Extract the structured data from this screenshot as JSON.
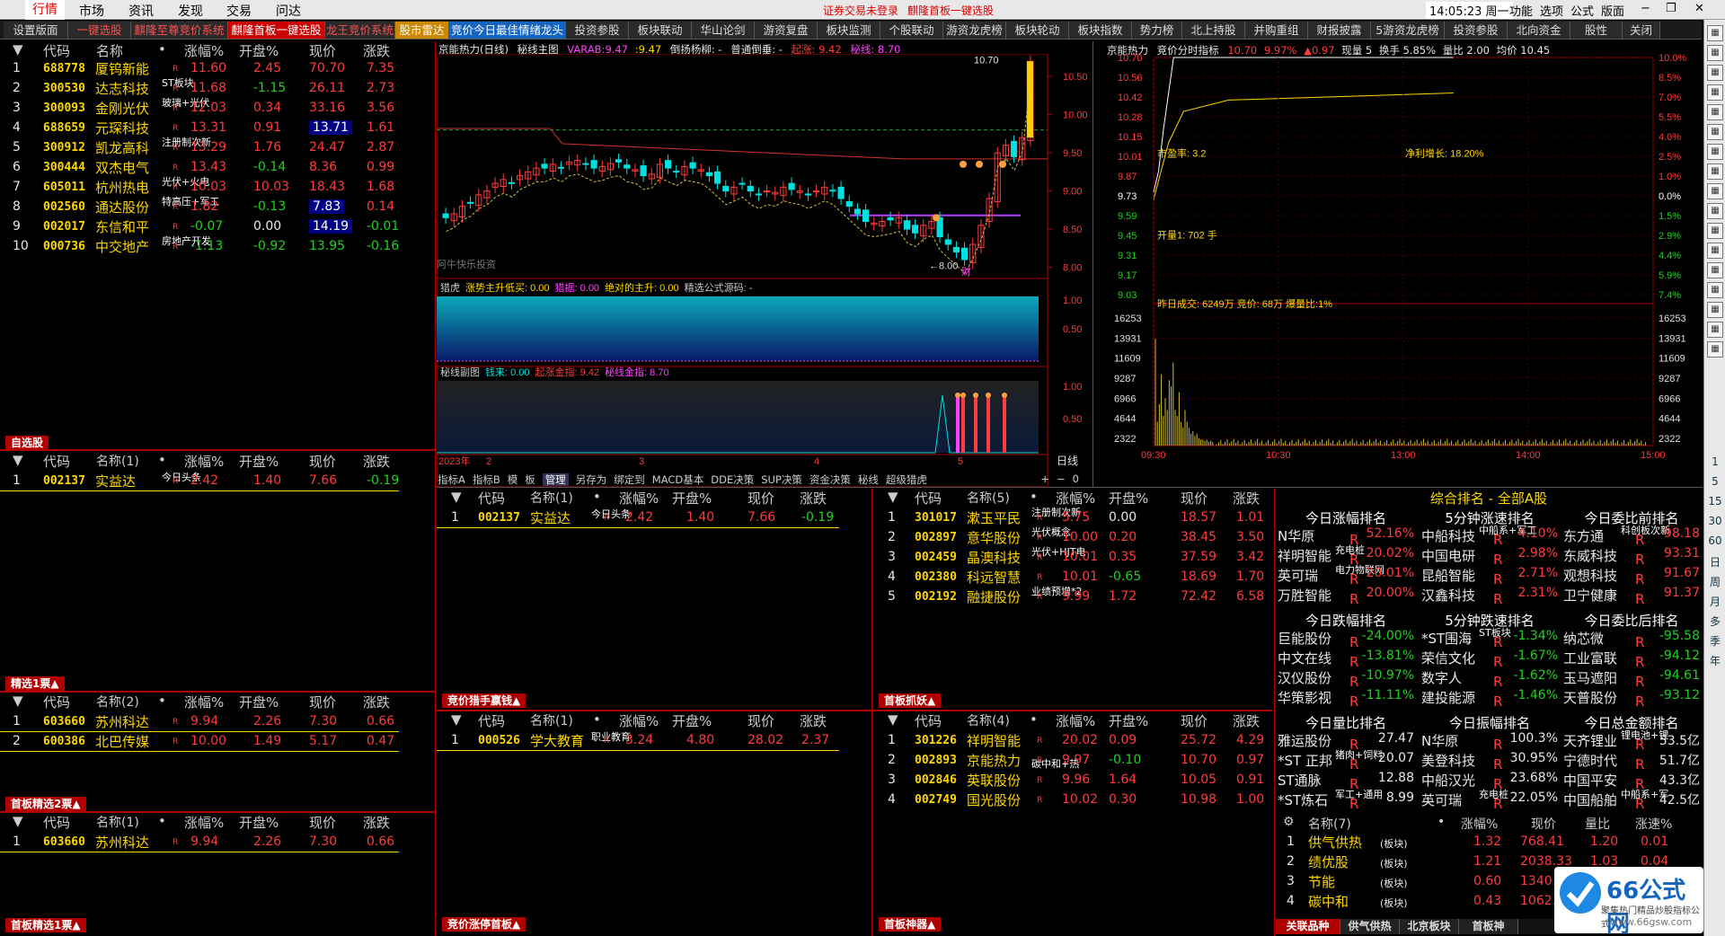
{
  "menu": {
    "items": [
      "行情",
      "市场",
      "资讯",
      "发现",
      "交易",
      "问达"
    ],
    "status_login": "证券交易未登录",
    "status_module": "麒隆首板一键选股",
    "clock": "14:05:23 周一",
    "right_items": [
      "功能",
      "选项",
      "公式",
      "版面",
      "−",
      "❐",
      "✕"
    ]
  },
  "tabs": [
    {
      "label": "设置版面",
      "style": "norm"
    },
    {
      "label": "一键选股",
      "style": "red"
    },
    {
      "label": "麒隆至尊竞价系统",
      "style": "red"
    },
    {
      "label": "麒隆首板一键选股",
      "style": "act"
    },
    {
      "label": "龙王竞价系统",
      "style": "red"
    },
    {
      "label": "股市雷达",
      "style": "yel"
    },
    {
      "label": "竞价今日最佳情绪龙头",
      "style": "cyn"
    },
    {
      "label": "投资参股",
      "style": "norm"
    },
    {
      "label": "板块联动",
      "style": "norm"
    },
    {
      "label": "华山论剑",
      "style": "norm"
    },
    {
      "label": "游资复盘",
      "style": "norm"
    },
    {
      "label": "板块监测",
      "style": "norm"
    },
    {
      "label": "个股联动",
      "style": "norm"
    },
    {
      "label": "游资龙虎榜",
      "style": "norm"
    },
    {
      "label": "板块轮动",
      "style": "norm"
    },
    {
      "label": "板块指数",
      "style": "norm"
    },
    {
      "label": "势力榜",
      "style": "norm"
    },
    {
      "label": "北上持股",
      "style": "norm"
    },
    {
      "label": "并购重组",
      "style": "norm"
    },
    {
      "label": "财报披露",
      "style": "norm"
    },
    {
      "label": "5游资龙虎榜",
      "style": "norm"
    },
    {
      "label": "投资参股",
      "style": "norm"
    },
    {
      "label": "北向资金",
      "style": "norm"
    },
    {
      "label": "股性",
      "style": "norm"
    },
    {
      "label": "关闭",
      "style": "norm"
    }
  ],
  "headers": {
    "code": "代码",
    "name": "名称",
    "dot": "•",
    "chg": "涨幅%",
    "open": "开盘%",
    "price": "现价",
    "diff": "涨跌"
  },
  "top_list": [
    {
      "n": "1",
      "code": "688778",
      "name": "厦钨新能",
      "tag": "",
      "chg": "11.60",
      "open": "2.45",
      "price": "70.70",
      "diff": "7.35",
      "oc": "red",
      "pc": "red",
      "hl": false
    },
    {
      "n": "2",
      "code": "300530",
      "name": "达志科技",
      "tag": "ST板块",
      "chg": "11.68",
      "open": "-1.15",
      "price": "26.11",
      "diff": "2.73",
      "oc": "grn",
      "pc": "red",
      "hl": false
    },
    {
      "n": "3",
      "code": "300093",
      "name": "金刚光伏",
      "tag": "玻璃+光伏",
      "chg": "12.03",
      "open": "0.34",
      "price": "33.16",
      "diff": "3.56",
      "oc": "red",
      "pc": "red",
      "hl": false
    },
    {
      "n": "4",
      "code": "688659",
      "name": "元琛科技",
      "tag": "",
      "chg": "13.31",
      "open": "0.91",
      "price": "13.71",
      "diff": "1.61",
      "oc": "red",
      "pc": "wht",
      "hl": true
    },
    {
      "n": "5",
      "code": "300912",
      "name": "凯龙高科",
      "tag": "注册制次新",
      "chg": "13.29",
      "open": "1.76",
      "price": "24.47",
      "diff": "2.87",
      "oc": "red",
      "pc": "red",
      "hl": false
    },
    {
      "n": "6",
      "code": "300444",
      "name": "双杰电气",
      "tag": "",
      "chg": "13.43",
      "open": "-0.14",
      "price": "8.36",
      "diff": "0.99",
      "oc": "grn",
      "pc": "red",
      "hl": false
    },
    {
      "n": "7",
      "code": "605011",
      "name": "杭州热电",
      "tag": "光伏+火电",
      "chg": "10.03",
      "open": "10.03",
      "price": "18.43",
      "diff": "1.68",
      "oc": "red",
      "pc": "red",
      "hl": false
    },
    {
      "n": "8",
      "code": "002560",
      "name": "通达股份",
      "tag": "特高压+军工",
      "chg": "1.82",
      "open": "-0.13",
      "price": "7.83",
      "diff": "0.14",
      "oc": "grn",
      "pc": "wht",
      "hl": true
    },
    {
      "n": "9",
      "code": "002017",
      "name": "东信和平",
      "tag": "",
      "chg": "-0.07",
      "open": "0.00",
      "price": "14.19",
      "diff": "-0.01",
      "oc": "wht",
      "pc": "wht",
      "hl": true
    },
    {
      "n": "10",
      "code": "000736",
      "name": "中交地产",
      "tag": "房地产开发",
      "chg": "-1.13",
      "open": "-0.92",
      "price": "13.95",
      "diff": "-0.16",
      "oc": "grn",
      "pc": "grn",
      "hl": false
    }
  ],
  "panel_titles": {
    "zixuan": "自选股",
    "jingxuan1": "精选1票▲",
    "shoubanjx2": "首板精选2票▲",
    "shoubanjx1": "首板精选1票▲",
    "jingjia_qs": "竞价猎手嬴钱▲",
    "jingjia_zt": "竞价涨停首板▲",
    "shoubanzq": "首板抓妖▲",
    "shoubansq": "首板神器▲",
    "guanlian": "关联品种"
  },
  "zixuan_list": [
    {
      "n": "1",
      "code": "002137",
      "name": "实益达",
      "tag": "今日头条",
      "chg": "2.42",
      "open": "1.40",
      "price": "7.66",
      "diff": "-0.19"
    }
  ],
  "zixuan_hdr_name": "名称(1)",
  "jx1_hdr_name": "名称(2)",
  "jx1_list": [
    {
      "n": "1",
      "code": "603660",
      "name": "苏州科达",
      "chg": "9.94",
      "open": "2.26",
      "price": "7.30",
      "diff": "0.66"
    },
    {
      "n": "2",
      "code": "600386",
      "name": "北巴传媒",
      "chg": "10.00",
      "open": "1.49",
      "price": "5.17",
      "diff": "0.47"
    }
  ],
  "jx2_hdr_name": "名称(1)",
  "jx2_list": [
    {
      "n": "1",
      "code": "603660",
      "name": "苏州科达",
      "chg": "9.94",
      "open": "2.26",
      "price": "7.30",
      "diff": "0.66"
    }
  ],
  "mid1_hdr_name": "名称(1)",
  "mid1_list": [
    {
      "n": "1",
      "code": "002137",
      "name": "实益达",
      "tag": "今日头条",
      "chg": "2.42",
      "open": "1.40",
      "price": "7.66",
      "diff": "-0.19"
    }
  ],
  "mid2_hdr_name": "名称(1)",
  "mid2_list": [
    {
      "n": "1",
      "code": "000526",
      "name": "学大教育",
      "tag": "职业教育",
      "chg": "3.24",
      "open": "4.80",
      "price": "28.02",
      "diff": "2.37"
    }
  ],
  "r1_hdr_name": "名称(5)",
  "r1_list": [
    {
      "n": "1",
      "code": "301017",
      "name": "漱玉平民",
      "tag": "注册制次新",
      "chg": "5.75",
      "open": "0.00",
      "price": "18.57",
      "diff": "1.01",
      "oc": "wht"
    },
    {
      "n": "2",
      "code": "002897",
      "name": "意华股份",
      "tag": "光伏概念",
      "chg": "10.00",
      "open": "0.20",
      "price": "38.45",
      "diff": "3.50",
      "oc": "red"
    },
    {
      "n": "3",
      "code": "002459",
      "name": "晶澳科技",
      "tag": "光伏+HJT电",
      "chg": "10.01",
      "open": "0.35",
      "price": "37.59",
      "diff": "3.42",
      "oc": "red"
    },
    {
      "n": "4",
      "code": "002380",
      "name": "科远智慧",
      "tag": "",
      "chg": "10.01",
      "open": "-0.65",
      "price": "18.69",
      "diff": "1.70",
      "oc": "grn"
    },
    {
      "n": "5",
      "code": "002192",
      "name": "融捷股份",
      "tag": "业绩预增*2",
      "chg": "9.99",
      "open": "1.72",
      "price": "72.42",
      "diff": "6.58",
      "oc": "red"
    }
  ],
  "r2_hdr_name": "名称(4)",
  "r2_list": [
    {
      "n": "1",
      "code": "301226",
      "name": "祥明智能",
      "tag": "",
      "chg": "20.02",
      "open": "0.09",
      "price": "25.72",
      "diff": "4.29",
      "oc": "red"
    },
    {
      "n": "2",
      "code": "002893",
      "name": "京能热力",
      "tag": "碳中和+热",
      "chg": "9.97",
      "open": "-0.10",
      "price": "10.70",
      "diff": "0.97",
      "oc": "grn"
    },
    {
      "n": "3",
      "code": "002846",
      "name": "英联股份",
      "tag": "",
      "chg": "9.96",
      "open": "1.64",
      "price": "10.05",
      "diff": "0.91",
      "oc": "red"
    },
    {
      "n": "4",
      "code": "002749",
      "name": "国光股份",
      "tag": "",
      "chg": "10.02",
      "open": "0.30",
      "price": "10.98",
      "diff": "1.00",
      "oc": "red"
    }
  ],
  "kline": {
    "title": "京能热力(日线)",
    "sub": "秘线主图",
    "varab_lbl": "VARAB:",
    "varab": "9.47",
    "val2": "9.47",
    "diyang": "倒扬杨柳: -",
    "putong": "普通倒垂: -",
    "qizhang": "起涨: 9.42",
    "mixian": "秘线: 8.70",
    "hi_label": "10.70",
    "lo_label": "8.00",
    "watermark": "阿牛快乐投资",
    "cai": "财",
    "yaxis": [
      "10.50",
      "10.00",
      "9.50",
      "9.00",
      "8.50",
      "8.00"
    ],
    "sub1_title": "猎虎",
    "sub1_a": "涨势主升低买: 0.00",
    "sub1_b": "猎据: 0.00",
    "sub1_c": "绝对的主升: 0.00",
    "sub1_d": "精选公式源码: -",
    "sub1_yaxis": [
      "1.00",
      "0.50"
    ],
    "sub2_title": "秘线副图",
    "sub2_a": "钱来: 0.00",
    "sub2_b": "起涨金指: 9.42",
    "sub2_c": "秘线金指: 8.70",
    "sub2_yaxis": [
      "1.00",
      "0.50"
    ],
    "x_year": "2023年",
    "x_ticks": [
      "2",
      "3",
      "4",
      "5"
    ],
    "period": "日线",
    "bottom_tabs": [
      "指标A",
      "指标B",
      "模",
      "板",
      "管理",
      "另存为",
      "绑定到",
      "MACD基本",
      "DDE决策",
      "SUP决策",
      "资金决策",
      "秘线",
      "超级猎虎"
    ],
    "bottom_right": [
      "+",
      "−",
      "0"
    ]
  },
  "intraday": {
    "title": "京能热力",
    "ind": "竞价分时指标",
    "price": "10.70",
    "pct": "9.97%",
    "chg": "▲0.97",
    "liangbi_lbl": "现量",
    "xianliang": "5",
    "huanshou": "换手 5.85%",
    "liangbi": "量比 2.00",
    "junjia": "均价 10.45",
    "pe": "市盈率: 3.2",
    "profit": "净利增长: 18.20%",
    "kaiju": "开量1: 702 手",
    "volinfo": "昨日成交: 6249万  竞价: 68万  爆量比:1%",
    "yl": [
      "10.70",
      "10.56",
      "10.42",
      "10.28",
      "10.15",
      "10.01",
      "9.87",
      "9.73",
      "9.59",
      "9.45",
      "9.31",
      "9.17",
      "9.03"
    ],
    "yr": [
      "10.0%",
      "8.5%",
      "7.0%",
      "5.5%",
      "4.0%",
      "2.5%",
      "1.0%",
      "0.0%",
      "1.5%",
      "2.9%",
      "4.4%",
      "5.9%",
      "7.4%"
    ],
    "vl": [
      "16253",
      "13931",
      "11609",
      "9287",
      "6966",
      "4644",
      "2322"
    ],
    "xt": [
      "09:30",
      "10:30",
      "13:00",
      "14:00",
      "15:00"
    ]
  },
  "ranking": {
    "title": "综合排名 - 全部A股",
    "blocks": [
      {
        "title": "今日涨幅排名",
        "rows": [
          {
            "name": "N华原",
            "v": "52.16%",
            "c": "red"
          },
          {
            "name": "祥明智能",
            "v": "20.02%",
            "c": "red",
            "tag": "充电桩"
          },
          {
            "name": "英可瑞",
            "v": "20.01%",
            "c": "red",
            "tag": "电力物联网"
          },
          {
            "name": "万胜智能",
            "v": "20.00%",
            "c": "red"
          }
        ]
      },
      {
        "title": "5分钟涨速排名",
        "rows": [
          {
            "name": "中船科技",
            "v": "4.10%",
            "c": "red",
            "tag": "中船系+军工"
          },
          {
            "name": "中国电研",
            "v": "2.98%",
            "c": "red"
          },
          {
            "name": "昆船智能",
            "v": "2.71%",
            "c": "red"
          },
          {
            "name": "汉鑫科技",
            "v": "2.31%",
            "c": "red"
          }
        ]
      },
      {
        "title": "今日委比前排名",
        "rows": [
          {
            "name": "东方通",
            "v": "98.18",
            "c": "red",
            "tag": "科创板次新"
          },
          {
            "name": "东威科技",
            "v": "93.31",
            "c": "red"
          },
          {
            "name": "观想科技",
            "v": "91.67",
            "c": "red"
          },
          {
            "name": "卫宁健康",
            "v": "91.37",
            "c": "red"
          }
        ]
      },
      {
        "title": "今日跌幅排名",
        "rows": [
          {
            "name": "巨能股份",
            "v": "-24.00%",
            "c": "grn"
          },
          {
            "name": "中文在线",
            "v": "-13.81%",
            "c": "grn"
          },
          {
            "name": "汉仪股份",
            "v": "-10.97%",
            "c": "grn"
          },
          {
            "name": "华策影视",
            "v": "-11.11%",
            "c": "grn"
          }
        ]
      },
      {
        "title": "5分钟跌速排名",
        "rows": [
          {
            "name": "*ST围海",
            "v": "-1.34%",
            "c": "grn",
            "tag": "ST板块"
          },
          {
            "name": "荣信文化",
            "v": "-1.67%",
            "c": "grn"
          },
          {
            "name": "数字人",
            "v": "-1.62%",
            "c": "grn"
          },
          {
            "name": "建投能源",
            "v": "-1.46%",
            "c": "grn"
          }
        ]
      },
      {
        "title": "今日委比后排名",
        "rows": [
          {
            "name": "纳芯微",
            "v": "-95.58",
            "c": "grn"
          },
          {
            "name": "工业富联",
            "v": "-94.12",
            "c": "grn"
          },
          {
            "name": "玉马遮阳",
            "v": "-94.61",
            "c": "grn"
          },
          {
            "name": "天普股份",
            "v": "-93.12",
            "c": "grn"
          }
        ]
      },
      {
        "title": "今日量比排名",
        "rows": [
          {
            "name": "雅运股份",
            "v": "27.47",
            "c": "wht"
          },
          {
            "name": "*ST 正邦",
            "v": "20.07",
            "c": "wht",
            "tag": "猪肉+饲料"
          },
          {
            "name": "ST通脉",
            "v": "12.88",
            "c": "wht"
          },
          {
            "name": "*ST炼石",
            "v": "8.99",
            "c": "wht",
            "tag": "军工+通用"
          }
        ]
      },
      {
        "title": "今日振幅排名",
        "rows": [
          {
            "name": "N华原",
            "v": "100.3%",
            "c": "wht"
          },
          {
            "name": "美登科技",
            "v": "30.95%",
            "c": "wht"
          },
          {
            "name": "中船汉光",
            "v": "23.68%",
            "c": "wht"
          },
          {
            "name": "英可瑞",
            "v": "22.05%",
            "c": "wht",
            "tag": "充电桩"
          }
        ]
      },
      {
        "title": "今日总金额排名",
        "rows": [
          {
            "name": "天齐锂业",
            "v": "53.5亿",
            "c": "wht",
            "tag": "锂电池+锂"
          },
          {
            "name": "宁德时代",
            "v": "51.7亿",
            "c": "wht"
          },
          {
            "name": "中国平安",
            "v": "43.3亿",
            "c": "wht"
          },
          {
            "name": "中国船舶",
            "v": "42.5亿",
            "c": "wht",
            "tag": "中船系+军"
          }
        ]
      }
    ]
  },
  "sector": {
    "hdr": {
      "name": "名称(7)",
      "dot": "•",
      "chg": "涨幅%",
      "price": "现价",
      "ratio": "量比",
      "speed": "涨速%"
    },
    "rows": [
      {
        "n": "1",
        "name": "供气供热",
        "tag": "(板块)",
        "chg": "1.32",
        "price": "768.41",
        "ratio": "1.20",
        "speed": "0.01"
      },
      {
        "n": "2",
        "name": "绩优股",
        "tag": "(板块)",
        "chg": "1.21",
        "price": "2038.33",
        "ratio": "1.03",
        "speed": "0.04"
      },
      {
        "n": "3",
        "name": "节能",
        "tag": "(板块)",
        "chg": "0.60",
        "price": "1340.93",
        "ratio": "1.04",
        "speed": "0.01"
      },
      {
        "n": "4",
        "name": "碳中和",
        "tag": "(板块)",
        "chg": "0.43",
        "price": "1062.74",
        "ratio": "1.03",
        "speed": "0.02"
      }
    ],
    "tabs": [
      "关联品种",
      "供气供热",
      "北京板块",
      "首板神"
    ]
  },
  "watermark": {
    "brand": "66公式网",
    "sub": "聚集热门精品炒股指标公式",
    "url": "www.66gsw.com"
  },
  "sidebar_texts": [
    "1",
    "5",
    "15",
    "30",
    "60",
    "日",
    "周",
    "月",
    "多",
    "季",
    "年"
  ],
  "colors": {
    "up": "#ff3b3b",
    "down": "#20d020",
    "accent": "#b00000",
    "code": "#ffd700"
  }
}
